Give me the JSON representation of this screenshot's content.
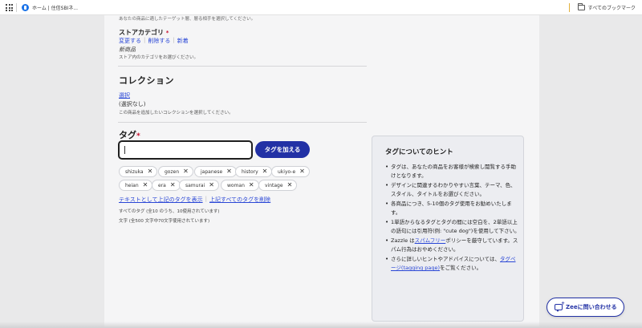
{
  "browser": {
    "bookmark_home": "ホーム | 住信SBIネ...",
    "all_bookmarks": "すべてのブックマーク"
  },
  "top_cut_text": "あなたの商品に適したテーゲット層、層る相手を選択してください。",
  "store_category": {
    "title": "ストアカテゴリ",
    "required_mark": "*",
    "links": [
      "変更する",
      "削除する",
      "新着"
    ],
    "value": "新商品",
    "help": "ストア内のカテゴリをお選びください。"
  },
  "collection": {
    "title": "コレクション",
    "select_link": "選択",
    "status": "(選択なし)",
    "help": "この商品を追加したいコレクションを選択してください。"
  },
  "tags": {
    "title": "タグ",
    "required_mark": "*",
    "input_value": "",
    "add_button": "タグを加える",
    "chips": [
      "shizuka",
      "gozen",
      "japanese",
      "history",
      "ukiyo-e",
      "heian",
      "era",
      "samurai",
      "woman",
      "vintage"
    ],
    "remove_glyph": "✕",
    "action_show_text": "テキストとして上記のタグを表示",
    "action_delete_all": "上記すべてのタグを削除",
    "count_text": "すべてのタグ (全10 のうち、10使用されています)",
    "char_text": "文字 (全500 文字中70文字使用されています)"
  },
  "hints": {
    "title": "タグについてのヒント",
    "items": [
      "タグは、あなたの商品をお客様が検索し閲覧する手助けとなります。",
      "デザインに関連するわかりやすい言葉、テーマ、色、スタイル、タイトルをお選びください。",
      "各商品につき、5-10個のタグ使用をお勧めいたします。",
      "1単語からなるタグとタグの間には空白を、2単語以上の語句には引用符(例: \"cute dog\")を使用して下さい。"
    ],
    "spam_prefix": "Zazzle は",
    "spam_link": "スパムフリー",
    "spam_suffix": "ポリシーを厳守しています。スパム行為はおやめください。",
    "more_prefix": "さらに詳しいヒントやアドバイスについては、",
    "more_link": "タグページ(tagging page)",
    "more_suffix": "をご覧ください。"
  },
  "zee": {
    "label": "Zeeに問い合わせる"
  },
  "colors": {
    "primary": "#2231a5",
    "link": "#2a47d6",
    "required": "#c8102e"
  }
}
